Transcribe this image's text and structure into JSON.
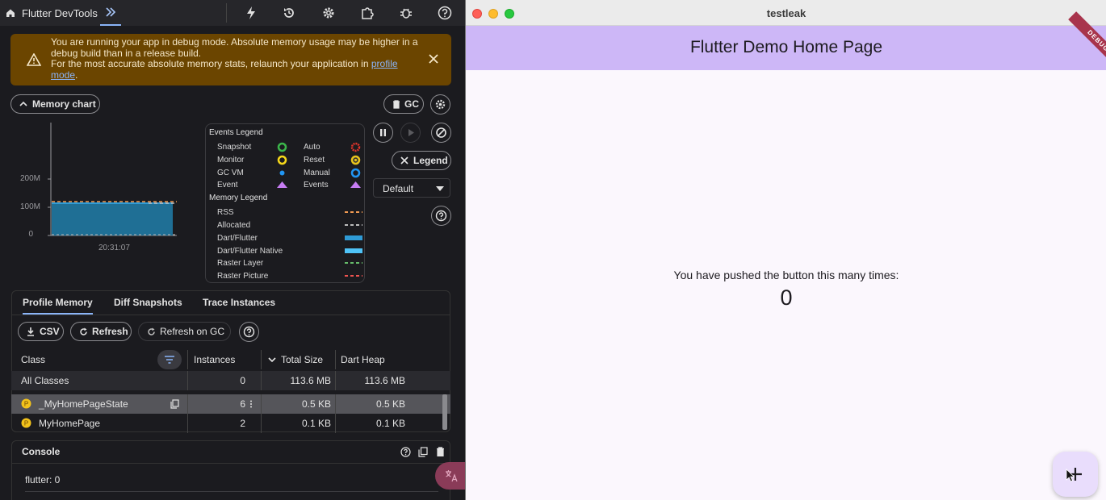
{
  "devtools": {
    "app_title": "Flutter DevTools",
    "banner": {
      "line1": "You are running your app in debug mode. Absolute memory usage may be higher in a debug build than in a release build.",
      "line2_prefix": "For the most accurate absolute memory stats, relaunch your application in ",
      "link_text": "profile mode",
      "line2_suffix": "."
    },
    "memory_chart_button": "Memory chart",
    "gc_button": "GC",
    "chart": {
      "y_ticks": [
        "200M",
        "100M",
        "0"
      ],
      "x_tick": "20:31:07"
    },
    "legend": {
      "events_title": "Events Legend",
      "events": [
        {
          "label": "Snapshot",
          "icon": "snapshot-ring-icon",
          "color": "#3bb54a"
        },
        {
          "label": "Auto",
          "icon": "auto-ring-icon",
          "color": "#e0352b"
        },
        {
          "label": "Monitor",
          "icon": "monitor-ring-icon",
          "color": "#f6d81a"
        },
        {
          "label": "Reset",
          "icon": "reset-ring-icon",
          "color": "#e8c31c"
        },
        {
          "label": "GC VM",
          "icon": "gc-vm-dot-icon",
          "color": "#2196f3"
        },
        {
          "label": "Manual",
          "icon": "manual-ring-icon",
          "color": "#2196f3"
        },
        {
          "label": "Event",
          "icon": "event-triangle-icon",
          "color": "#c77df3"
        },
        {
          "label": "Events",
          "icon": "events-triangle-icon",
          "color": "#c77df3"
        }
      ],
      "memory_title": "Memory Legend",
      "memory": [
        {
          "label": "RSS",
          "color": "#f09a52",
          "style": "dashed"
        },
        {
          "label": "Allocated",
          "color": "#bdbdbd",
          "style": "dashed"
        },
        {
          "label": "Dart/Flutter",
          "color": "#2f9bd6",
          "style": "solid"
        },
        {
          "label": "Dart/Flutter Native",
          "color": "#4fc3f7",
          "style": "solid"
        },
        {
          "label": "Raster Layer",
          "color": "#66bb6a",
          "style": "dashed"
        },
        {
          "label": "Raster Picture",
          "color": "#ef5350",
          "style": "dashed"
        }
      ]
    },
    "legend_button": "Legend",
    "interval_select": "Default",
    "tabs": [
      "Profile Memory",
      "Diff Snapshots",
      "Trace Instances"
    ],
    "toolbar": {
      "csv": "CSV",
      "refresh": "Refresh",
      "refresh_on_gc": "Refresh on GC"
    },
    "table": {
      "headers": [
        "Class",
        "Instances",
        "Total Size",
        "Dart Heap"
      ],
      "rows": [
        {
          "name": "All Classes",
          "instances": "0",
          "total": "113.6 MB",
          "heap": "113.6 MB"
        },
        {
          "name": "_MyHomePageState",
          "instances": "6",
          "total": "0.5 KB",
          "heap": "0.5 KB"
        },
        {
          "name": "MyHomePage",
          "instances": "2",
          "total": "0.1 KB",
          "heap": "0.1 KB"
        }
      ]
    },
    "console": {
      "title": "Console",
      "lines": [
        "flutter: 0"
      ]
    },
    "colors": {
      "accent": "#8ab4f8",
      "banner_bg": "#6b4500",
      "chart_fill": "#1f6f95"
    }
  },
  "app": {
    "window_title": "testleak",
    "appbar_title": "Flutter Demo Home Page",
    "debug_banner": "DEBUG",
    "counter_label": "You have pushed the button this many times:",
    "counter_value": "0",
    "fab_icon": "add-icon",
    "colors": {
      "appbar": "#cdb7f7",
      "background": "#fbf7fd",
      "fab": "#e9ddfc"
    }
  }
}
